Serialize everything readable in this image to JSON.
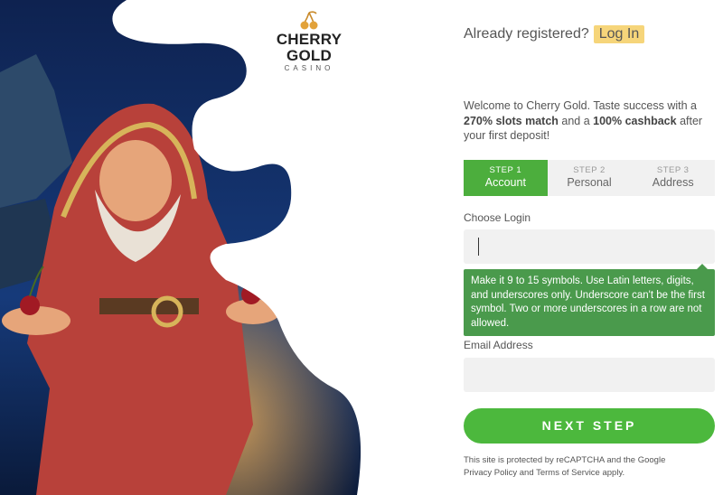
{
  "logo": {
    "brand": "CHERRY GOLD",
    "sub": "CASINO",
    "icon": "cherries-icon"
  },
  "header": {
    "already_registered": "Already registered?",
    "login_label": "Log In"
  },
  "welcome": {
    "part1": "Welcome to Cherry Gold. Taste success with a ",
    "bold1": "270% slots match",
    "part2": " and a ",
    "bold2": "100% cashback",
    "part3": " after your first deposit!"
  },
  "steps": [
    {
      "num": "STEP 1",
      "name": "Account",
      "active": true
    },
    {
      "num": "STEP 2",
      "name": "Personal",
      "active": false
    },
    {
      "num": "STEP 3",
      "name": "Address",
      "active": false
    }
  ],
  "form": {
    "login_label": "Choose Login",
    "login_value": "",
    "tooltip": "Make it 9 to 15 symbols. Use Latin letters, digits, and underscores only. Underscore can't be the first symbol. Two or more underscores in a row are not allowed.",
    "email_label": "Email Address",
    "email_value": ""
  },
  "next_step_label": "NEXT STEP",
  "recaptcha": {
    "text1": "This site is protected by reCAPTCHA and the Google",
    "privacy": "Privacy Policy",
    "and": " and ",
    "terms": "Terms of Service",
    "apply": " apply."
  },
  "colors": {
    "accent_green": "#4cb83d",
    "step_active": "#4cae3d",
    "tooltip_green": "#4a9a4c",
    "login_highlight": "#f6d57a"
  }
}
